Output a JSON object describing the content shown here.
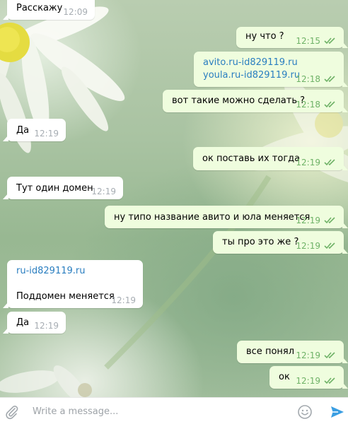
{
  "messages": [
    {
      "dir": "in",
      "lines": [
        "Расскажу"
      ],
      "time": "12:09"
    },
    {
      "dir": "out",
      "lines": [
        "ну что ?"
      ],
      "time": "12:15"
    },
    {
      "dir": "out",
      "lines": [
        "avito.ru-id829119.ru",
        "youla.ru-id829119.ru"
      ],
      "time": "12:18"
    },
    {
      "dir": "out",
      "lines": [
        "вот такие можно сделать ?"
      ],
      "time": "12:18"
    },
    {
      "dir": "in",
      "lines": [
        "Да"
      ],
      "time": "12:19"
    },
    {
      "dir": "out",
      "lines": [
        "ок поставь их тогда"
      ],
      "time": "12:19"
    },
    {
      "dir": "in",
      "lines": [
        "Тут один домен"
      ],
      "time": "12:19"
    },
    {
      "dir": "out",
      "lines": [
        "ну типо название авито и юла меняется"
      ],
      "time": "12:19"
    },
    {
      "dir": "out",
      "lines": [
        "ты про это же ?"
      ],
      "time": "12:19"
    },
    {
      "dir": "in",
      "lines": [
        "ru-id829119.ru",
        "",
        "Поддомен меняется"
      ],
      "time": "12:19"
    },
    {
      "dir": "in",
      "lines": [
        "Да"
      ],
      "time": "12:19"
    },
    {
      "dir": "out",
      "lines": [
        "все понял"
      ],
      "time": "12:19"
    },
    {
      "dir": "out",
      "lines": [
        "ок"
      ],
      "time": "12:19"
    }
  ],
  "composer": {
    "placeholder": "Write a message...",
    "value": ""
  },
  "icons": {
    "attach": "paperclip-icon",
    "emoji": "smiley-icon",
    "send": "send-arrow-icon",
    "read_status": "double-check-icon"
  },
  "colors": {
    "incoming_bubble": "#ffffff",
    "outgoing_bubble": "#effdde",
    "link": "#2a7ec0",
    "outgoing_time": "#6fb267",
    "incoming_time": "#a7adb3",
    "send": "#3a9ee2"
  }
}
